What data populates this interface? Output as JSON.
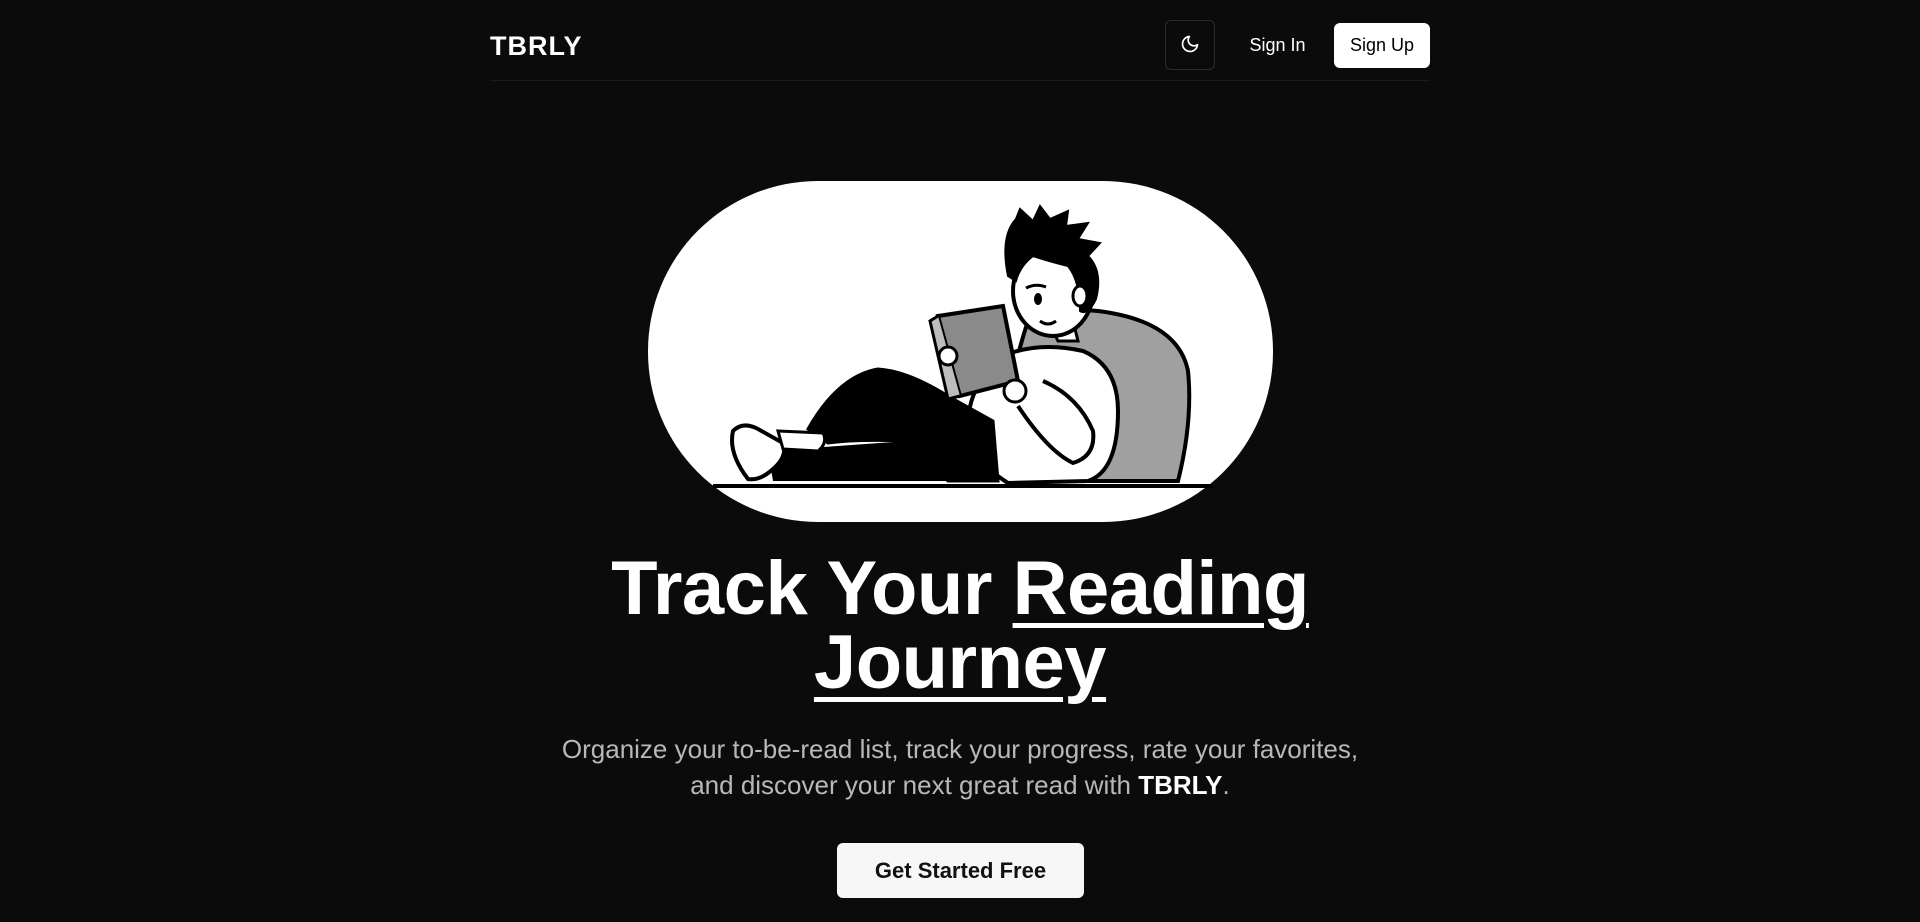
{
  "header": {
    "logo": "TBRLY",
    "theme_toggle_icon": "moon-icon",
    "sign_in_label": "Sign In",
    "sign_up_label": "Sign Up"
  },
  "hero": {
    "illustration": "person-reading-book-illustration",
    "headline_part1": "Track Your ",
    "headline_part2": "Reading",
    "headline_part3": "Journey",
    "subtitle_line1": "Organize your to-be-read list, track your progress, rate your favorites,",
    "subtitle_line2_prefix": "and discover your next great read with ",
    "subtitle_brand": "TBRLY",
    "subtitle_suffix": ".",
    "cta_label": "Get Started Free"
  },
  "colors": {
    "background": "#0b0b0b",
    "text": "#ffffff",
    "muted_text": "#b8b8b8",
    "button_light": "#ffffff"
  }
}
